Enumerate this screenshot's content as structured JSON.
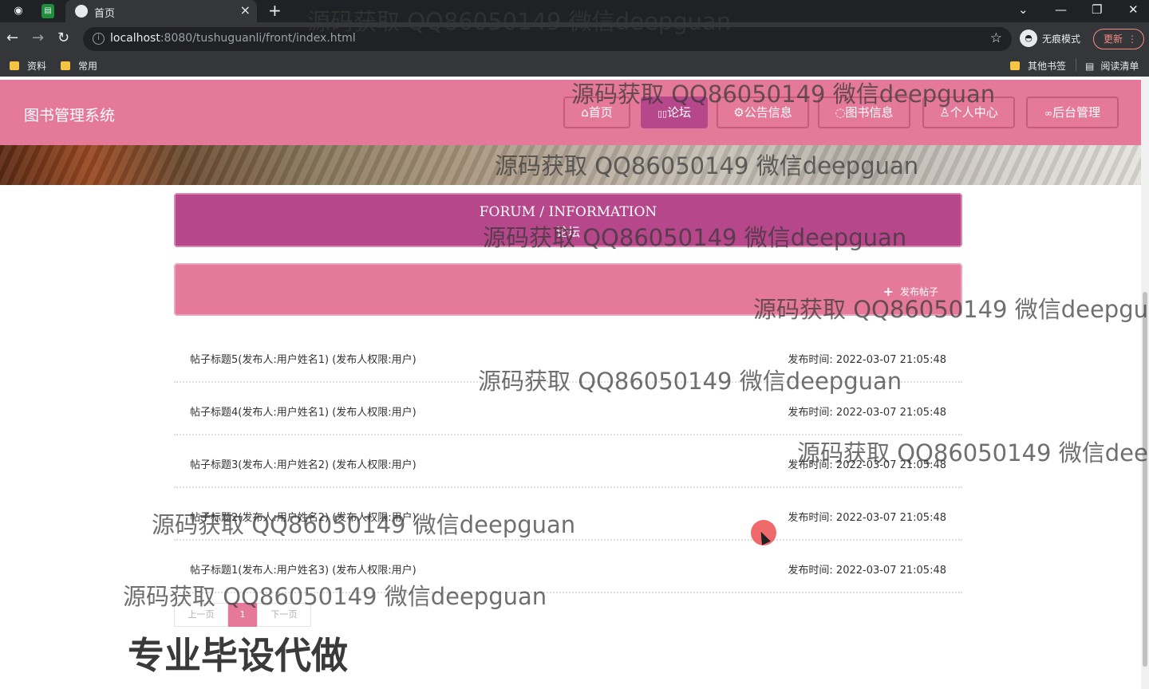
{
  "browser": {
    "tab_title": "首页",
    "url_host": "localhost",
    "url_rest": ":8080/tushuguanli/front/index.html",
    "incognito_label": "无痕模式",
    "update_label": "更新",
    "bookmarks": [
      "资料",
      "常用"
    ],
    "other_bookmarks": "其他书签",
    "reading_list": "阅读清单"
  },
  "site": {
    "title": "图书管理系统",
    "nav": [
      {
        "label": "首页",
        "icon": "home-icon",
        "glyph": "⌂"
      },
      {
        "label": "论坛",
        "icon": "forum-icon",
        "glyph": "▯▯"
      },
      {
        "label": "公告信息",
        "icon": "notice-icon",
        "glyph": "⚙"
      },
      {
        "label": "图书信息",
        "icon": "book-icon",
        "glyph": "◌"
      },
      {
        "label": "个人中心",
        "icon": "user-icon",
        "glyph": "♙"
      },
      {
        "label": "后台管理",
        "icon": "link-icon",
        "glyph": "🔗"
      }
    ],
    "active_nav": "论坛"
  },
  "forum": {
    "heading_en": "FORUM / INFORMATION",
    "heading_cn": "论坛",
    "post_button": "发布帖子",
    "time_label": "发布时间:",
    "posts": [
      {
        "title": "帖子标题5(发布人:用户姓名1) (发布人权限:用户)",
        "time": "2022-03-07 21:05:48"
      },
      {
        "title": "帖子标题4(发布人:用户姓名1) (发布人权限:用户)",
        "time": "2022-03-07 21:05:48"
      },
      {
        "title": "帖子标题3(发布人:用户姓名2) (发布人权限:用户)",
        "time": "2022-03-07 21:05:48"
      },
      {
        "title": "帖子标题2(发布人:用户姓名2) (发布人权限:用户)",
        "time": "2022-03-07 21:05:48"
      },
      {
        "title": "帖子标题1(发布人:用户姓名3) (发布人权限:用户)",
        "time": "2022-03-07 21:05:48"
      }
    ]
  },
  "pagination": {
    "prev": "上一页",
    "current": "1",
    "next": "下一页"
  },
  "watermark": {
    "text": "源码获取 QQ86050149 微信deepguan",
    "promo": "专业毕设代做"
  }
}
